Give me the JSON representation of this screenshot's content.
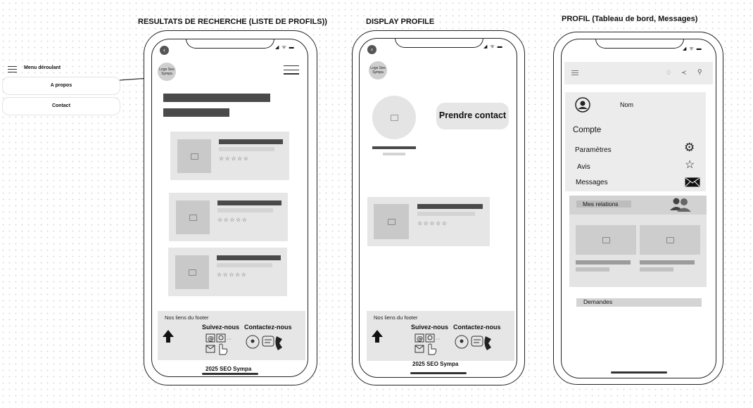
{
  "titles": {
    "search_results": "RESULTATS DE RECHERCHE (LISTE DE PROFILS))",
    "display_profile": "DISPLAY PROFILE",
    "profile_dashboard": "PROFIL (Tableau de bord, Messages)"
  },
  "menu": {
    "label": "Menu déroulant",
    "items": [
      "A propos",
      "Contact"
    ]
  },
  "phone_common": {
    "logo": "Logo Seo Sympa",
    "status": "◢ ᯤ ▬",
    "stars": "☆☆☆☆☆",
    "footer_title": "Nos liens du footer",
    "follow_label": "Suivez-nous",
    "contact_label": "Contactez-nous",
    "copyright": "2025 SEO Sympa"
  },
  "display_profile": {
    "contact_button": "Prendre contact"
  },
  "dashboard": {
    "name": "Nom",
    "account": "Compte",
    "settings": "Paramètres",
    "reviews": "Avis",
    "messages": "Messages",
    "relations": "Mes relations",
    "requests": "Demandes"
  }
}
